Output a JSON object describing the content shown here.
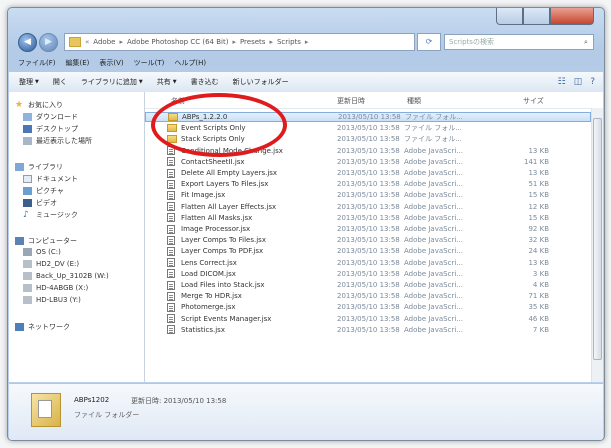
{
  "address_bar": {
    "crumbs": [
      "Adobe",
      "Adobe Photoshop CC (64 Bit)",
      "Presets",
      "Scripts"
    ],
    "search_placeholder": "Scriptsの検索"
  },
  "menu": [
    "ファイル(F)",
    "編集(E)",
    "表示(V)",
    "ツール(T)",
    "ヘルプ(H)"
  ],
  "toolbar": {
    "organize": "整理",
    "open": "開く",
    "include_library": "ライブラリに追加",
    "share": "共有",
    "burn": "書き込む",
    "new_folder": "新しいフォルダー"
  },
  "nav": {
    "favorites": "お気に入り",
    "download": "ダウンロード",
    "desktop": "デスクトップ",
    "recent": "最近表示した場所",
    "libraries": "ライブラリ",
    "documents": "ドキュメント",
    "pictures": "ピクチャ",
    "videos": "ビデオ",
    "music": "ミュージック",
    "computer": "コンピューター",
    "drive_os": "OS (C:)",
    "drive_hd2": "HD2_DV (E:)",
    "drive_back": "Back_Up_3102B (W:)",
    "drive_hd4": "HD-4ABGB (X:)",
    "drive_hd5": "HD-LBU3 (Y:)",
    "network": "ネットワーク"
  },
  "columns": {
    "name": "名前",
    "date": "更新日時",
    "type": "種類",
    "size": "サイズ"
  },
  "files": [
    {
      "name": "ABPs_1.2.2.0",
      "kind": "folder",
      "date": "2013/05/10 13:58",
      "type": "ファイル フォル...",
      "size": ""
    },
    {
      "name": "Event Scripts Only",
      "kind": "folder",
      "date": "2013/05/10 13:58",
      "type": "ファイル フォル...",
      "size": ""
    },
    {
      "name": "Stack Scripts Only",
      "kind": "folder",
      "date": "2013/05/10 13:58",
      "type": "ファイル フォル...",
      "size": ""
    },
    {
      "name": "Conditional Mode Change.jsx",
      "kind": "script",
      "date": "2013/05/10 13:58",
      "type": "Adobe JavaScri...",
      "size": "13 KB"
    },
    {
      "name": "ContactSheetII.jsx",
      "kind": "script",
      "date": "2013/05/10 13:58",
      "type": "Adobe JavaScri...",
      "size": "141 KB"
    },
    {
      "name": "Delete All Empty Layers.jsx",
      "kind": "script",
      "date": "2013/05/10 13:58",
      "type": "Adobe JavaScri...",
      "size": "13 KB"
    },
    {
      "name": "Export Layers To Files.jsx",
      "kind": "script",
      "date": "2013/05/10 13:58",
      "type": "Adobe JavaScri...",
      "size": "51 KB"
    },
    {
      "name": "Fit Image.jsx",
      "kind": "script",
      "date": "2013/05/10 13:58",
      "type": "Adobe JavaScri...",
      "size": "15 KB"
    },
    {
      "name": "Flatten All Layer Effects.jsx",
      "kind": "script",
      "date": "2013/05/10 13:58",
      "type": "Adobe JavaScri...",
      "size": "12 KB"
    },
    {
      "name": "Flatten All Masks.jsx",
      "kind": "script",
      "date": "2013/05/10 13:58",
      "type": "Adobe JavaScri...",
      "size": "15 KB"
    },
    {
      "name": "Image Processor.jsx",
      "kind": "script",
      "date": "2013/05/10 13:58",
      "type": "Adobe JavaScri...",
      "size": "92 KB"
    },
    {
      "name": "Layer Comps To Files.jsx",
      "kind": "script",
      "date": "2013/05/10 13:58",
      "type": "Adobe JavaScri...",
      "size": "32 KB"
    },
    {
      "name": "Layer Comps To PDF.jsx",
      "kind": "script",
      "date": "2013/05/10 13:58",
      "type": "Adobe JavaScri...",
      "size": "24 KB"
    },
    {
      "name": "Lens Correct.jsx",
      "kind": "script",
      "date": "2013/05/10 13:58",
      "type": "Adobe JavaScri...",
      "size": "13 KB"
    },
    {
      "name": "Load DICOM.jsx",
      "kind": "script",
      "date": "2013/05/10 13:58",
      "type": "Adobe JavaScri...",
      "size": "3 KB"
    },
    {
      "name": "Load Files into Stack.jsx",
      "kind": "script",
      "date": "2013/05/10 13:58",
      "type": "Adobe JavaScri...",
      "size": "4 KB"
    },
    {
      "name": "Merge To HDR.jsx",
      "kind": "script",
      "date": "2013/05/10 13:58",
      "type": "Adobe JavaScri...",
      "size": "71 KB"
    },
    {
      "name": "Photomerge.jsx",
      "kind": "script",
      "date": "2013/05/10 13:58",
      "type": "Adobe JavaScri...",
      "size": "35 KB"
    },
    {
      "name": "Script Events Manager.jsx",
      "kind": "script",
      "date": "2013/05/10 13:58",
      "type": "Adobe JavaScri...",
      "size": "46 KB"
    },
    {
      "name": "Statistics.jsx",
      "kind": "script",
      "date": "2013/05/10 13:58",
      "type": "Adobe JavaScri...",
      "size": "7 KB"
    }
  ],
  "details": {
    "name": "ABPs1202",
    "modified_label": "更新日時: 2013/05/10 13:58",
    "type": "ファイル フォルダー"
  }
}
